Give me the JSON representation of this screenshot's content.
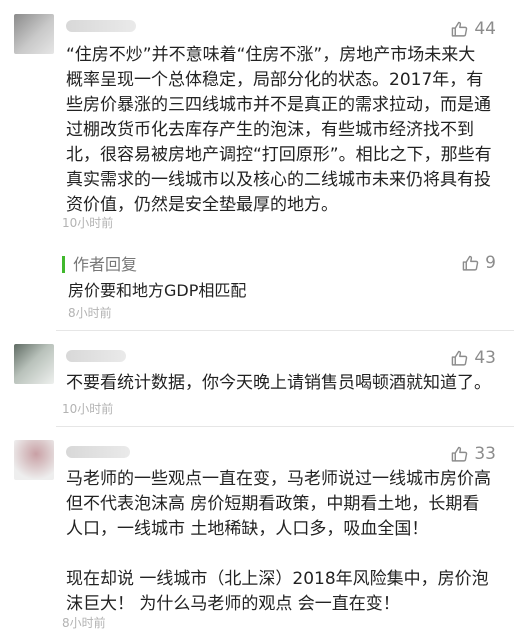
{
  "comments": [
    {
      "likes": "44",
      "text": "“住房不炒”并不意味着“住房不涨”，房地产市场未来大概率呈现一个总体稳定，局部分化的状态。2017年，有些房价暴涨的三四线城市并不是真正的需求拉动，而是通过棚改货币化去库存产生的泡沫，有些城市经济找不到北，很容易被房地产调控“打回原形”。相比之下，那些有真实需求的一线城市以及核心的二线城市未来仍将具有投资价值，仍然是安全垫最厚的地方。",
      "time": "10小时前",
      "reply": {
        "label": "作者回复",
        "likes": "9",
        "text": "房价要和地方GDP相匹配",
        "time": "8小时前"
      }
    },
    {
      "likes": "43",
      "text": "不要看统计数据，你今天晚上请销售员喝顿酒就知道了。",
      "time": "10小时前"
    },
    {
      "likes": "33",
      "text_p1": "马老师的一些观点一直在变，马老师说过一线城市房价高但不代表泡沫高 房价短期看政策，中期看土地，长期看人口，一线城市 土地稀缺，人口多，吸血全国！",
      "text_p2": "现在却说 一线城市（北上深）2018年风险集中，房价泡沫巨大！ 为什么马老师的观点 会一直在变！",
      "time": "8小时前"
    }
  ],
  "icons": {
    "like": "thumbs-up-icon"
  },
  "colors": {
    "reply_accent": "#40b82d",
    "muted": "#b3b3b3"
  }
}
